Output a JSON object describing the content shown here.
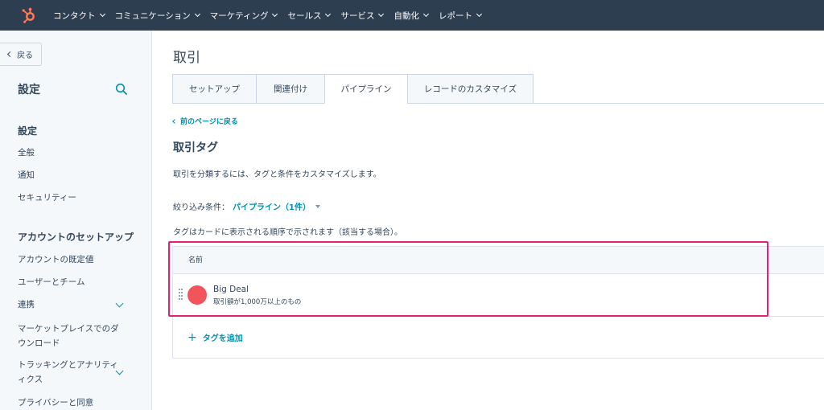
{
  "topnav": {
    "items": [
      "コンタクト",
      "コミュニケーション",
      "マーケティング",
      "セールス",
      "サービス",
      "自動化",
      "レポート"
    ],
    "logo_color": "#ff7a59"
  },
  "sidebar": {
    "back_label": "戻る",
    "title": "設定",
    "sections": {
      "settings": "設定",
      "account_setup": "アカウントのセットアップ"
    },
    "items": [
      "全般",
      "通知",
      "セキュリティー",
      "アカウントの既定値",
      "ユーザーとチーム",
      "連携",
      "マーケットプレイスでのダ",
      "ウンロード",
      "トラッキングとアナリティ",
      "ィクス",
      "プライバシーと同意"
    ]
  },
  "main": {
    "page_title": "取引",
    "tabs": [
      "セットアップ",
      "関連付け",
      "パイプライン",
      "レコードのカスタマイズ"
    ],
    "active_tab": "パイプライン",
    "prev_link": "前のページに戻る",
    "section_title": "取引タグ",
    "description": "取引を分類するには、タグと条件をカスタマイズします。",
    "filter_label": "絞り込み条件：",
    "filter_value": "パイプライン（1件）",
    "order_note": "タグはカードに表示される順序で示されます（該当する場合）。",
    "table": {
      "header": "名前",
      "rows": [
        {
          "name": "Big Deal",
          "desc": "取引額が1,000万以上のもの",
          "color": "#f2545b"
        }
      ],
      "add_label": "タグを追加"
    }
  },
  "colors": {
    "nav_bg": "#2d3e50",
    "accent": "#0091ae",
    "highlight": "#e2227a"
  }
}
